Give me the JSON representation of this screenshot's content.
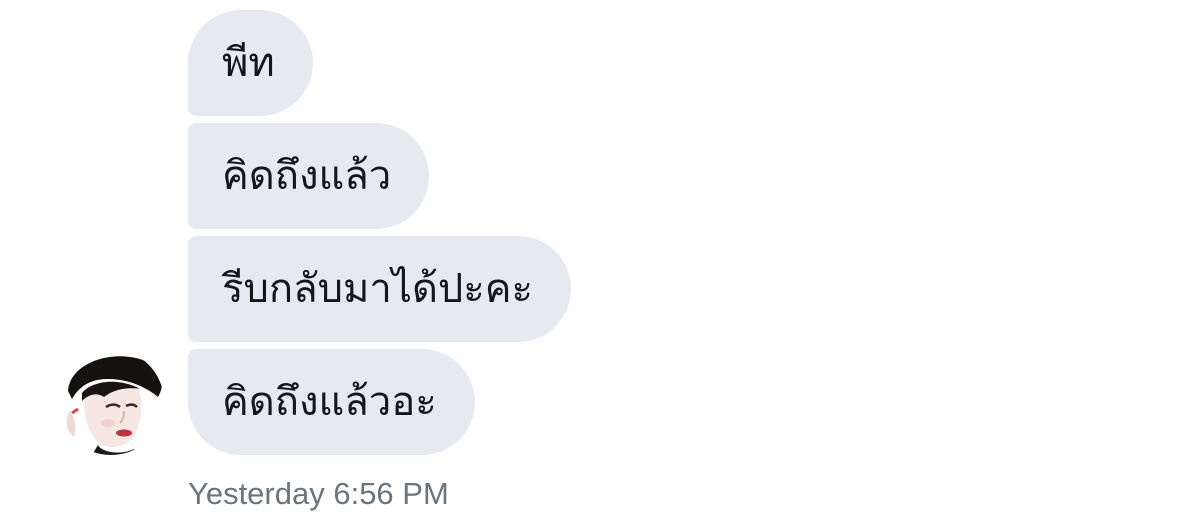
{
  "conversation": {
    "messages": [
      {
        "text": "พีท"
      },
      {
        "text": "คิดถึงแล้ว"
      },
      {
        "text": "รีบกลับมาได้ปะคะ"
      },
      {
        "text": "คิดถึงแล้วอะ"
      }
    ],
    "timestamp": "Yesterday 6:56 PM",
    "bubble_color": "#e6e9f0",
    "text_color": "#14171a",
    "timestamp_color": "#6a7580"
  },
  "sender": {
    "avatar_icon": "user-avatar-photo"
  }
}
